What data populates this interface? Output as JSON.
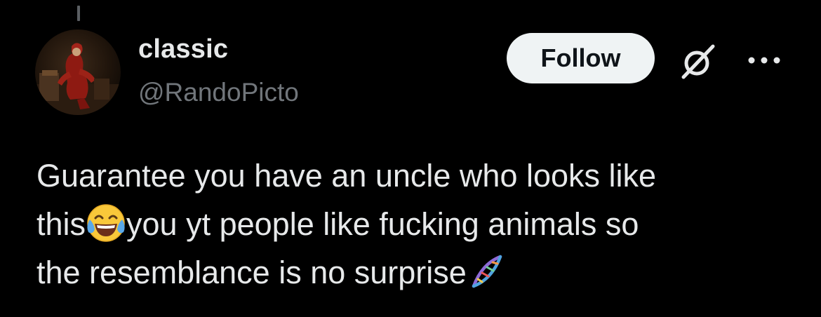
{
  "post": {
    "author": {
      "display_name": "classic",
      "handle": "@RandoPicto"
    },
    "follow_label": "Follow",
    "text": {
      "line1": "Guarantee you have an uncle who looks like",
      "line2_before": "this",
      "line2_after": "you yt people like fucking animals so",
      "line3": "the resemblance is no surprise"
    },
    "emojis": [
      "face-with-tears-of-joy-icon",
      "dna-icon"
    ]
  },
  "icons": {
    "grok": "grok-icon",
    "more": "more-icon"
  },
  "colors": {
    "background": "#000000",
    "text_primary": "#e7e9ea",
    "text_secondary": "#71767b",
    "follow_bg": "#eff3f4",
    "follow_text": "#0f1419"
  }
}
